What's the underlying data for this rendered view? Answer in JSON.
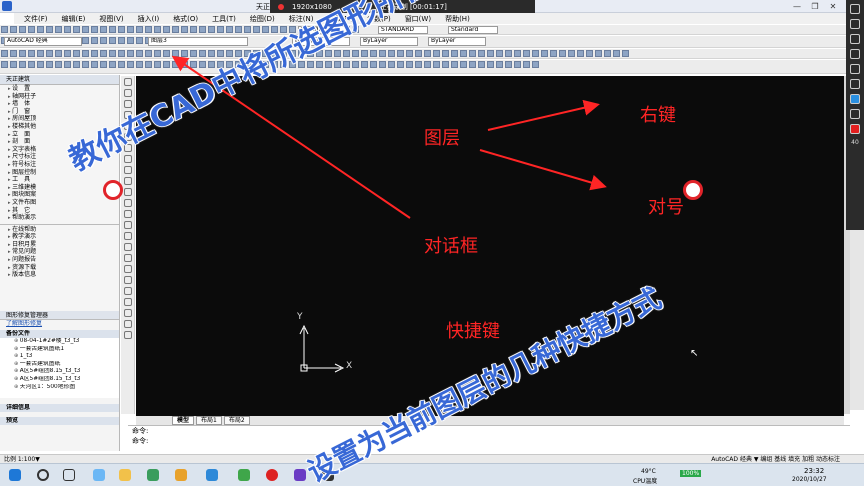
{
  "window": {
    "title": "天正建",
    "recording_resolution": "1920x1080",
    "recording_status": "正在录制 [00:01:17]"
  },
  "menus": [
    "文件(F)",
    "编辑(E)",
    "视图(V)",
    "插入(I)",
    "格式(O)",
    "工具(T)",
    "绘图(D)",
    "标注(N)",
    "修改(M)",
    "参数(P)",
    "窗口(W)",
    "帮助(H)"
  ],
  "toolbar": {
    "workspace": "AutoCAD 经典",
    "layer": "图层3",
    "color": "ByLayer",
    "linetype": "ByLayer",
    "lineweight": "ByLayer",
    "textstyle": "Standard",
    "dimstyle": "STANDARD",
    "tablestyle": "Standard"
  },
  "tianzheng": {
    "title": "天正建筑",
    "items": [
      "设　置",
      "轴网柱子",
      "墙　体",
      "门　窗",
      "房间屋顶",
      "楼梯其他",
      "立　面",
      "剖　面",
      "文字表格",
      "尺寸标注",
      "符号标注",
      "图层控制",
      "工　具",
      "三维建模",
      "图块图案",
      "文件布图",
      "其　它",
      "帮助演示"
    ],
    "extras": [
      "在线帮助",
      "教学演示",
      "日积月累",
      "常见问题",
      "问题报告",
      "资源下载",
      "版本信息"
    ]
  },
  "repair": {
    "title": "图形修复管理器",
    "link": "了解图形修复",
    "section": "备份文件",
    "files": [
      "08-04-1#2#楼_t3_t3",
      "一套古建筑图纸1",
      "1_t3",
      "一套古建筑图纸",
      "A区5#组团8.15_t3_t3",
      "A区5#组团8.15_t3_t3",
      "天河区1：500地形图"
    ],
    "details": "详细信息",
    "preview": "预览"
  },
  "tabs": [
    "模型",
    "布局1",
    "布局2"
  ],
  "command": {
    "line1": "命令:",
    "line2": "命令:"
  },
  "status": {
    "left": "比例 1:100▼",
    "right": "AutoCAD 经典 ▼ 编组 基线 填充 加粗 动态标注"
  },
  "taskbar": {
    "weather": "49°C",
    "weather_sub": "CPU温度",
    "battery": "100%",
    "time": "23:32",
    "date": "2020/10/27"
  },
  "axis": {
    "y": "Y",
    "x": "X"
  },
  "overlay": {
    "layer": "图层",
    "right_click": "右键",
    "confirm": "对号",
    "dialog": "对话框",
    "shortcut": "快捷键",
    "headline1": "教你在CAD中将所选图形所在图层",
    "headline2": "设置为当前图层的几种快捷方式"
  },
  "colors": {
    "annotation_red": "#ff2525",
    "headline_blue": "#3868d6",
    "canvas": "#0b0b0b"
  },
  "side_tools": {
    "font_size": "40"
  }
}
